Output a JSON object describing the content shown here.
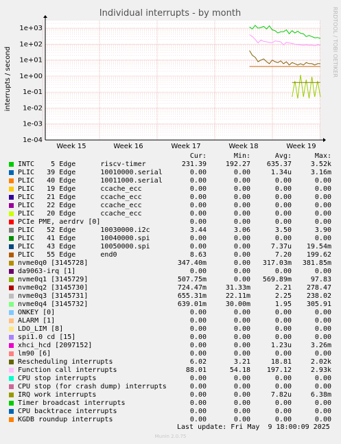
{
  "chart_data": {
    "type": "line",
    "title": "Individual interrupts - by month",
    "ylabel": "interrupts / second",
    "yscale": "log",
    "ylim": [
      0.0001,
      3000
    ],
    "yticks": [
      "1e+03",
      "1e+02",
      "1e+01",
      "1e+00",
      "1e-01",
      "1e-02",
      "1e-03",
      "1e-04"
    ],
    "xticks": [
      "Week 15",
      "Week 16",
      "Week 17",
      "Week 18",
      "Week 19"
    ],
    "grid": true,
    "side_label": "RRDTOOL / TOBI OETIKER",
    "series": [
      {
        "name": "INTC    5 Edge      riscv-timer",
        "color": "#00cc00",
        "values": [
          null,
          null,
          null,
          null,
          null,
          null,
          null,
          null,
          null,
          null,
          null,
          null,
          null,
          null,
          null,
          null,
          null,
          null,
          null,
          null,
          null,
          null,
          null,
          null,
          null,
          null,
          null,
          null,
          null,
          null,
          null,
          null,
          null,
          null,
          null,
          null,
          null,
          null,
          null,
          null,
          null,
          null,
          null,
          null,
          null,
          null,
          null,
          null,
          null,
          null,
          null,
          null,
          null,
          null,
          null,
          null,
          null,
          null,
          null,
          null,
          null,
          null,
          null,
          null,
          null,
          null,
          null,
          null,
          null,
          null,
          null,
          null,
          1200,
          900,
          1500,
          1000,
          1100,
          1300,
          900,
          1400,
          800,
          700,
          500,
          600,
          600,
          800,
          450,
          700,
          500,
          650,
          480,
          450,
          300,
          350,
          300,
          250,
          260,
          230
        ]
      },
      {
        "name": "Function call interrupts",
        "color": "#ff99ff",
        "values": [
          null,
          null,
          null,
          null,
          null,
          null,
          null,
          null,
          null,
          null,
          null,
          null,
          null,
          null,
          null,
          null,
          null,
          null,
          null,
          null,
          null,
          null,
          null,
          null,
          null,
          null,
          null,
          null,
          null,
          null,
          null,
          null,
          null,
          null,
          null,
          null,
          null,
          null,
          null,
          null,
          null,
          null,
          null,
          null,
          null,
          null,
          null,
          null,
          null,
          null,
          null,
          null,
          null,
          null,
          null,
          null,
          null,
          null,
          null,
          null,
          null,
          null,
          null,
          null,
          null,
          null,
          null,
          null,
          null,
          null,
          null,
          null,
          400,
          300,
          200,
          120,
          180,
          150,
          140,
          130,
          120,
          160,
          150,
          140,
          90,
          130,
          120,
          110,
          100,
          95,
          90,
          85,
          90,
          85,
          88,
          80,
          90,
          88
        ]
      },
      {
        "name": "Rescheduling interrupts",
        "color": "#806000",
        "values": [
          null,
          null,
          null,
          null,
          null,
          null,
          null,
          null,
          null,
          null,
          null,
          null,
          null,
          null,
          null,
          null,
          null,
          null,
          null,
          null,
          null,
          null,
          null,
          null,
          null,
          null,
          null,
          null,
          null,
          null,
          null,
          null,
          null,
          null,
          null,
          null,
          null,
          null,
          null,
          null,
          null,
          null,
          null,
          null,
          null,
          null,
          null,
          null,
          null,
          null,
          null,
          null,
          null,
          null,
          null,
          null,
          null,
          null,
          null,
          null,
          null,
          null,
          null,
          null,
          null,
          null,
          null,
          null,
          null,
          null,
          null,
          null,
          40,
          20,
          15,
          8,
          10,
          12,
          8,
          6,
          10,
          8,
          7,
          9,
          6,
          8,
          5,
          7,
          6,
          5,
          6,
          5,
          7,
          6,
          6,
          5,
          6,
          6
        ]
      },
      {
        "name": "PLIC   55 Edge      end0",
        "color": "#c8600a",
        "values": [
          null,
          null,
          null,
          null,
          null,
          null,
          null,
          null,
          null,
          null,
          null,
          null,
          null,
          null,
          null,
          null,
          null,
          null,
          null,
          null,
          null,
          null,
          null,
          null,
          null,
          null,
          null,
          null,
          null,
          null,
          null,
          null,
          null,
          null,
          null,
          null,
          null,
          null,
          null,
          null,
          null,
          null,
          null,
          null,
          null,
          null,
          null,
          null,
          null,
          null,
          null,
          null,
          null,
          null,
          null,
          null,
          null,
          null,
          null,
          null,
          null,
          null,
          null,
          null,
          null,
          null,
          null,
          null,
          null,
          null,
          null,
          null,
          4,
          4,
          4,
          4,
          4,
          4,
          4,
          4,
          4,
          4,
          4,
          4,
          4,
          4,
          4,
          4,
          4,
          4,
          4,
          4,
          4,
          4,
          4,
          4,
          4,
          4
        ]
      },
      {
        "name": "nvme0q1 [3145729]",
        "color": "#99cc00",
        "values": [
          null,
          null,
          null,
          null,
          null,
          null,
          null,
          null,
          null,
          null,
          null,
          null,
          null,
          null,
          null,
          null,
          null,
          null,
          null,
          null,
          null,
          null,
          null,
          null,
          null,
          null,
          null,
          null,
          null,
          null,
          null,
          null,
          null,
          null,
          null,
          null,
          null,
          null,
          null,
          null,
          null,
          null,
          null,
          null,
          null,
          null,
          null,
          null,
          null,
          null,
          null,
          null,
          null,
          null,
          null,
          null,
          null,
          null,
          null,
          null,
          null,
          null,
          null,
          null,
          null,
          null,
          null,
          null,
          null,
          null,
          null,
          null,
          null,
          null,
          null,
          null,
          null,
          null,
          null,
          null,
          null,
          null,
          null,
          null,
          null,
          null,
          null,
          0.05,
          0.5,
          0.04,
          1.2,
          0.05,
          0.6,
          0.04,
          0.9,
          0.05,
          0.5,
          0.05
        ]
      },
      {
        "name": "PLIC   52 Edge      10030000.i2c",
        "color": "#7f7f00",
        "values": [
          null,
          null,
          null,
          null,
          null,
          null,
          null,
          null,
          null,
          null,
          null,
          null,
          null,
          null,
          null,
          null,
          null,
          null,
          null,
          null,
          null,
          null,
          null,
          null,
          null,
          null,
          null,
          null,
          null,
          null,
          null,
          null,
          null,
          null,
          null,
          null,
          null,
          null,
          null,
          null,
          null,
          null,
          null,
          null,
          null,
          null,
          null,
          null,
          null,
          null,
          null,
          null,
          null,
          null,
          null,
          null,
          null,
          null,
          null,
          null,
          null,
          null,
          null,
          null,
          null,
          null,
          null,
          null,
          null,
          null,
          null,
          null,
          null,
          null,
          null,
          null,
          null,
          null,
          null,
          null,
          null,
          null,
          null,
          null,
          null,
          null,
          null,
          0.4,
          0.4,
          0.4,
          0.4,
          0.4,
          0.4,
          0.4,
          0.4,
          0.4,
          0.4,
          0.4
        ]
      }
    ]
  },
  "legend": {
    "headers": {
      "cur": "Cur:",
      "min": "Min:",
      "avg": "Avg:",
      "max": "Max:"
    },
    "rows": [
      {
        "label": "INTC    5 Edge      riscv-timer",
        "color": "#00cc00",
        "cur": "231.39",
        "min": "192.27",
        "avg": "635.37",
        "max": "3.52k"
      },
      {
        "label": "PLIC   39 Edge      10010000.serial",
        "color": "#0066b3",
        "cur": "0.00",
        "min": "0.00",
        "avg": "1.34u",
        "max": "3.16m"
      },
      {
        "label": "PLIC   40 Edge      10011000.serial",
        "color": "#ff8000",
        "cur": "0.00",
        "min": "0.00",
        "avg": "0.00",
        "max": "0.00"
      },
      {
        "label": "PLIC   19 Edge      ccache_ecc",
        "color": "#ffcc00",
        "cur": "0.00",
        "min": "0.00",
        "avg": "0.00",
        "max": "0.00"
      },
      {
        "label": "PLIC   21 Edge      ccache_ecc",
        "color": "#330099",
        "cur": "0.00",
        "min": "0.00",
        "avg": "0.00",
        "max": "0.00"
      },
      {
        "label": "PLIC   22 Edge      ccache_ecc",
        "color": "#990099",
        "cur": "0.00",
        "min": "0.00",
        "avg": "0.00",
        "max": "0.00"
      },
      {
        "label": "PLIC   20 Edge      ccache_ecc",
        "color": "#ccff00",
        "cur": "0.00",
        "min": "0.00",
        "avg": "0.00",
        "max": "0.00"
      },
      {
        "label": "PCIe PME, aerdrv [0]",
        "color": "#ff0000",
        "cur": "0.00",
        "min": "0.00",
        "avg": "0.00",
        "max": "0.00"
      },
      {
        "label": "PLIC   52 Edge      10030000.i2c",
        "color": "#808080",
        "cur": "3.44",
        "min": "3.06",
        "avg": "3.50",
        "max": "3.90"
      },
      {
        "label": "PLIC   41 Edge      10040000.spi",
        "color": "#008f00",
        "cur": "0.00",
        "min": "0.00",
        "avg": "0.00",
        "max": "0.00"
      },
      {
        "label": "PLIC   43 Edge      10050000.spi",
        "color": "#00487d",
        "cur": "0.00",
        "min": "0.00",
        "avg": "7.37u",
        "max": "19.54m"
      },
      {
        "label": "PLIC   55 Edge      end0",
        "color": "#b35a00",
        "cur": "8.63",
        "min": "0.00",
        "avg": "7.20",
        "max": "199.62"
      },
      {
        "label": "nvme0q0 [3145728]",
        "color": "#b38f00",
        "cur": "347.40m",
        "min": "0.00",
        "avg": "317.03m",
        "max": "381.85m"
      },
      {
        "label": "da9063-irq [1]",
        "color": "#6b006b",
        "cur": "0.00",
        "min": "0.00",
        "avg": "0.00",
        "max": "0.00"
      },
      {
        "label": "nvme0q1 [3145729]",
        "color": "#8fb300",
        "cur": "507.75m",
        "min": "0.00",
        "avg": "569.89m",
        "max": "97.83"
      },
      {
        "label": "nvme0q2 [3145730]",
        "color": "#b30000",
        "cur": "724.47m",
        "min": "31.33m",
        "avg": "2.21",
        "max": "278.47"
      },
      {
        "label": "nvme0q3 [3145731]",
        "color": "#bebebe",
        "cur": "655.31m",
        "min": "22.11m",
        "avg": "2.25",
        "max": "238.02"
      },
      {
        "label": "nvme0q4 [3145732]",
        "color": "#80ff80",
        "cur": "639.01m",
        "min": "30.00m",
        "avg": "1.95",
        "max": "305.91"
      },
      {
        "label": "ONKEY [0]",
        "color": "#80c9ff",
        "cur": "0.00",
        "min": "0.00",
        "avg": "0.00",
        "max": "0.00"
      },
      {
        "label": "ALARM [1]",
        "color": "#ffc080",
        "cur": "0.00",
        "min": "0.00",
        "avg": "0.00",
        "max": "0.00"
      },
      {
        "label": "LDO_LIM [8]",
        "color": "#ffe680",
        "cur": "0.00",
        "min": "0.00",
        "avg": "0.00",
        "max": "0.00"
      },
      {
        "label": "spi1.0 cd [15]",
        "color": "#aa80ff",
        "cur": "0.00",
        "min": "0.00",
        "avg": "0.00",
        "max": "0.00"
      },
      {
        "label": "xhci_hcd [2097152]",
        "color": "#ee00cc",
        "cur": "0.00",
        "min": "0.00",
        "avg": "1.23u",
        "max": "3.26m"
      },
      {
        "label": "lm90 [6]",
        "color": "#ff8080",
        "cur": "0.00",
        "min": "0.00",
        "avg": "0.00",
        "max": "0.00"
      },
      {
        "label": "Rescheduling interrupts",
        "color": "#666600",
        "cur": "6.02",
        "min": "3.21",
        "avg": "18.81",
        "max": "2.02k"
      },
      {
        "label": "Function call interrupts",
        "color": "#ffbfff",
        "cur": "88.01",
        "min": "54.18",
        "avg": "197.12",
        "max": "2.93k"
      },
      {
        "label": "CPU stop interrupts",
        "color": "#00ffcc",
        "cur": "0.00",
        "min": "0.00",
        "avg": "0.00",
        "max": "0.00"
      },
      {
        "label": "CPU stop (for crash dump) interrupts",
        "color": "#cc6699",
        "cur": "0.00",
        "min": "0.00",
        "avg": "0.00",
        "max": "0.00"
      },
      {
        "label": "IRQ work interrupts",
        "color": "#999900",
        "cur": "0.00",
        "min": "0.00",
        "avg": "7.82u",
        "max": "6.38m"
      },
      {
        "label": "Timer broadcast interrupts",
        "color": "#00cc00",
        "cur": "0.00",
        "min": "0.00",
        "avg": "0.00",
        "max": "0.00"
      },
      {
        "label": "CPU backtrace interrupts",
        "color": "#0066b3",
        "cur": "0.00",
        "min": "0.00",
        "avg": "0.00",
        "max": "0.00"
      },
      {
        "label": "KGDB roundup interrupts",
        "color": "#ff8000",
        "cur": "0.00",
        "min": "0.00",
        "avg": "0.00",
        "max": "0.00"
      }
    ]
  },
  "footer": {
    "last_update": "Last update: Fri May  9 18:00:09 2025",
    "munin": "Munin 2.0.75"
  }
}
